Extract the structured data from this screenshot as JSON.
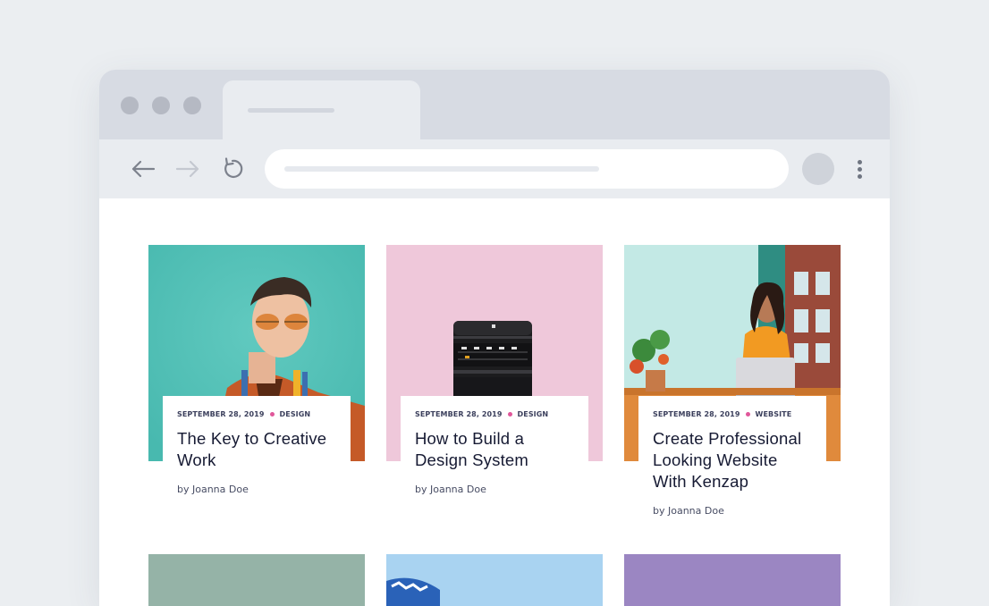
{
  "browser": {
    "controls": [
      "close",
      "minimize",
      "maximize"
    ],
    "nav_icons": [
      "back-arrow-icon",
      "forward-arrow-icon",
      "reload-icon"
    ],
    "colors": {
      "titlebar": "#d7dbe3",
      "toolbar": "#e9ecf0",
      "page_bg": "#ebeef1"
    }
  },
  "posts": [
    {
      "date": "SEPTEMBER 28, 2019",
      "category": "DESIGN",
      "title": "The Key to Creative Work",
      "author": "by Joanna Doe",
      "image_bg": "#4fc1b8"
    },
    {
      "date": "SEPTEMBER 28, 2019",
      "category": "DESIGN",
      "title": "How to Build a Design System",
      "author": "by Joanna Doe",
      "image_bg": "#efc7d9"
    },
    {
      "date": "SEPTEMBER 28, 2019",
      "category": "WEBSITE",
      "title": "Create Professional Looking Website With Kenzap",
      "author": "by Joanna Doe",
      "image_bg": "#bfe6e3"
    }
  ],
  "accent_color": "#e0579a"
}
